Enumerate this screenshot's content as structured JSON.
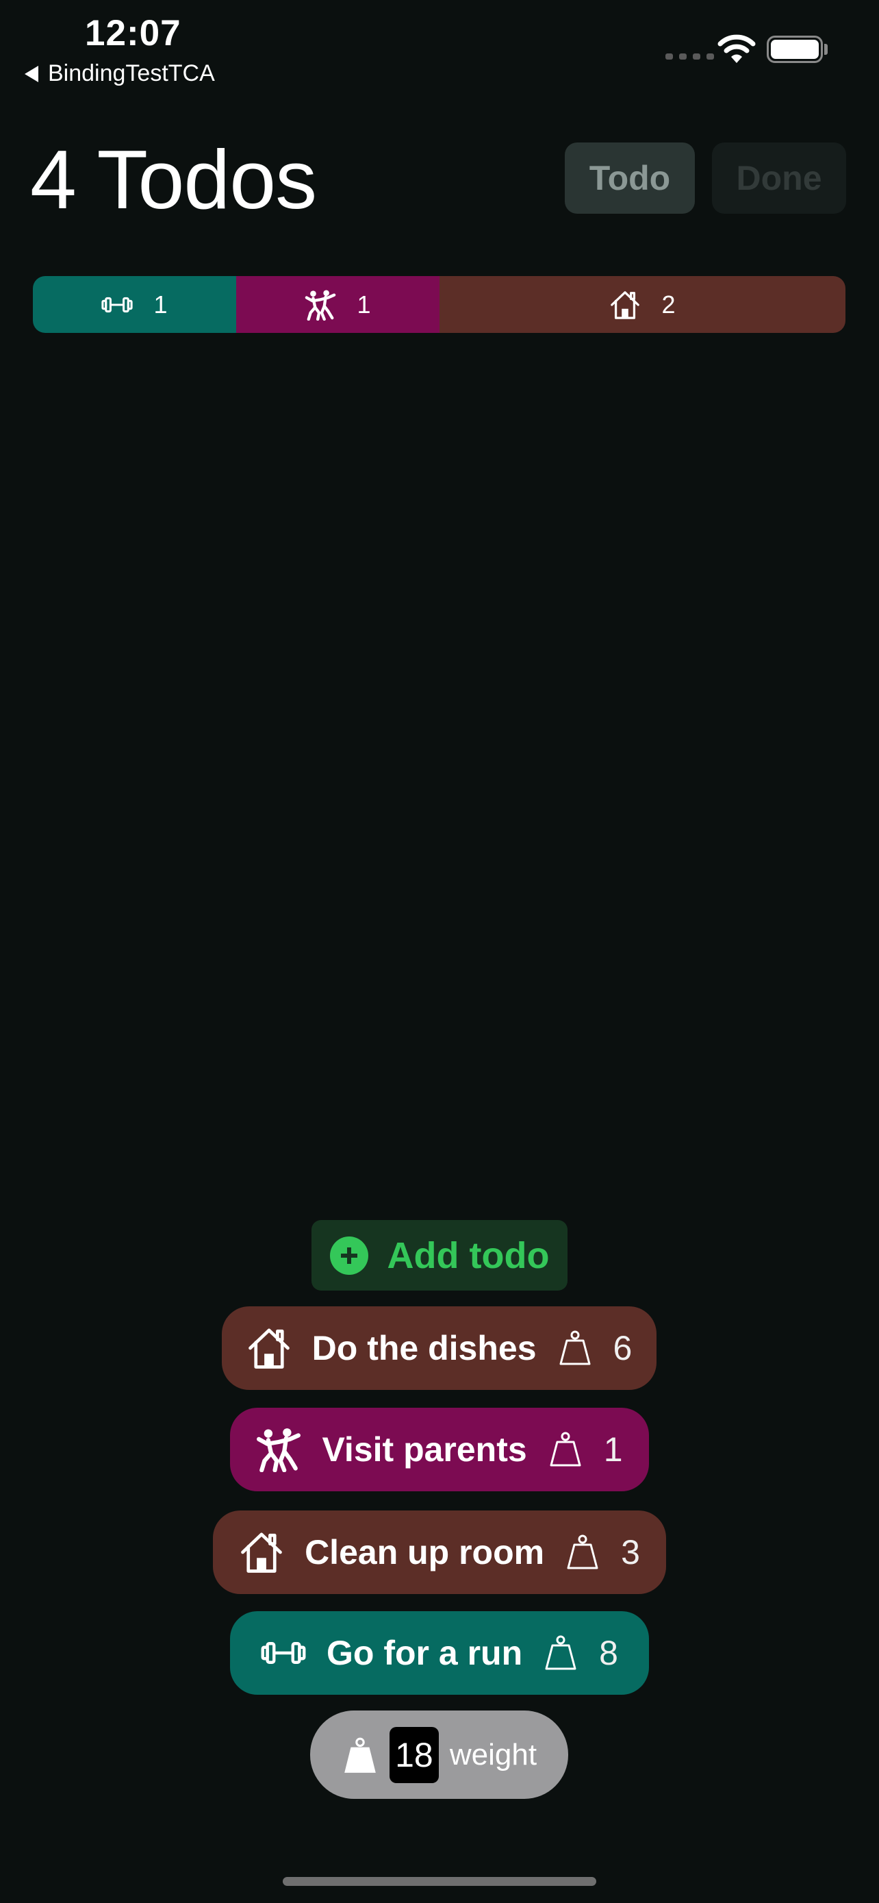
{
  "status_bar": {
    "time": "12:07",
    "back_label": "BindingTestTCA"
  },
  "header": {
    "title": "4 Todos",
    "filters": [
      {
        "label": "Todo",
        "selected": true
      },
      {
        "label": "Done",
        "selected": false
      }
    ]
  },
  "category_counts": [
    {
      "icon": "dumbbell-icon",
      "count": "1",
      "color": "#066b61"
    },
    {
      "icon": "dancing-people-icon",
      "count": "1",
      "color": "#7c0b52"
    },
    {
      "icon": "house-icon",
      "count": "2",
      "color": "#5c2e27"
    }
  ],
  "add_todo": {
    "label": "Add todo",
    "color": "#34c759"
  },
  "todos": [
    {
      "title": "Do the dishes",
      "icon": "house-icon",
      "weight": "6",
      "color": "#5c2e27"
    },
    {
      "title": "Visit parents",
      "icon": "dancing-people-icon",
      "weight": "1",
      "color": "#7c0b52"
    },
    {
      "title": "Clean up room",
      "icon": "house-icon",
      "weight": "3",
      "color": "#5c2e27"
    },
    {
      "title": "Go for a run",
      "icon": "dumbbell-icon",
      "weight": "8",
      "color": "#066b61"
    }
  ],
  "total": {
    "value": "18",
    "label": "weight"
  }
}
